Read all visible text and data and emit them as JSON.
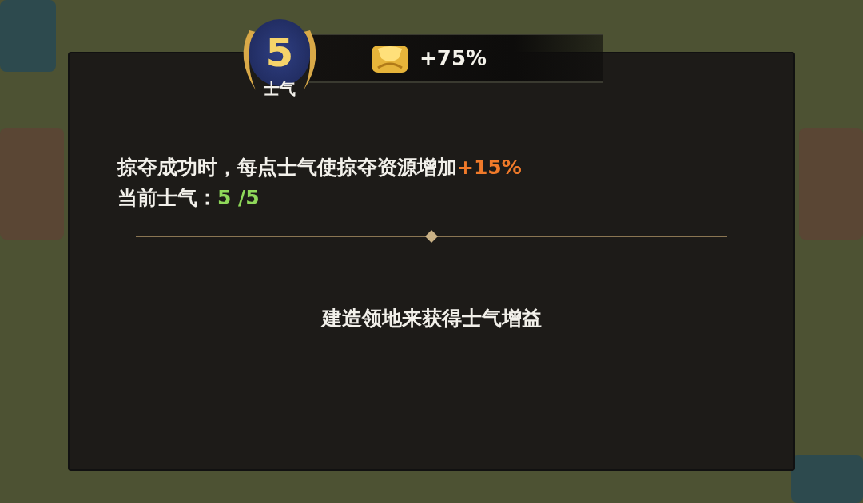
{
  "badge": {
    "value": "5",
    "label": "士气"
  },
  "header": {
    "bonus": "+75%"
  },
  "description": {
    "text": "掠夺成功时，每点士气使掠夺资源增加",
    "bonus": "+15%"
  },
  "current": {
    "label": "当前士气：",
    "value": "5 /5"
  },
  "hint": "建造领地来获得士气增益"
}
